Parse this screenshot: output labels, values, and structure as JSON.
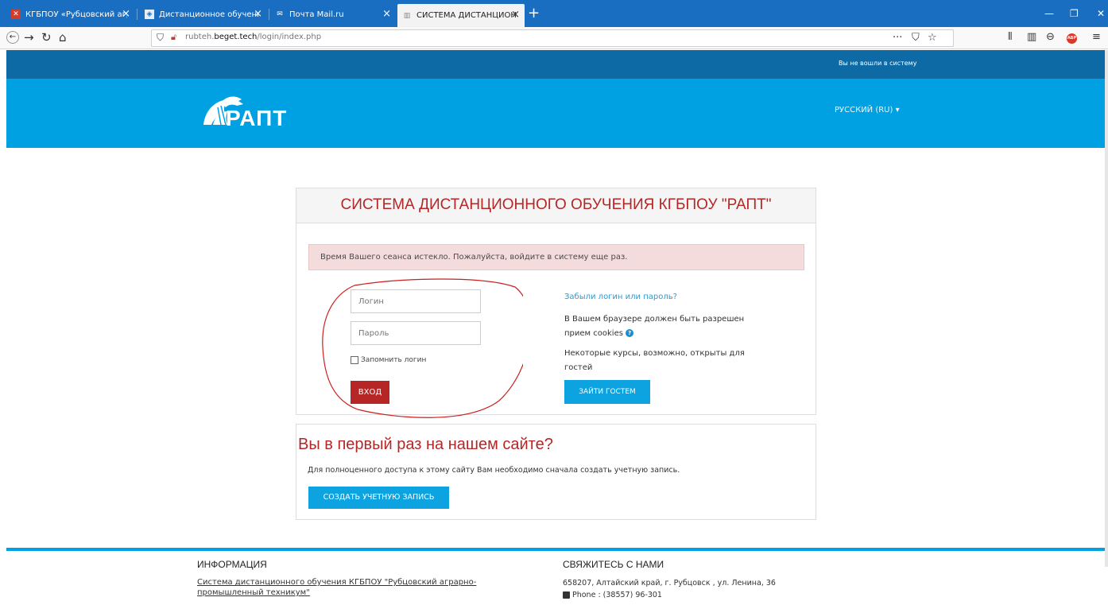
{
  "browser": {
    "tabs": [
      {
        "label": "КГБПОУ «Рубцовский аграрно",
        "active": false,
        "icon": "college-favicon-icon"
      },
      {
        "label": "Дистанционное обучение",
        "active": false,
        "icon": "shield-favicon-icon"
      },
      {
        "label": "Почта Mail.ru",
        "active": false,
        "icon": "mail-favicon-icon"
      },
      {
        "label": "СИСТЕМА ДИСТАНЦИОННО",
        "active": true,
        "icon": "moodle-favicon-icon"
      }
    ],
    "url_prefix": "rubteh.",
    "url_host": "beget.tech",
    "url_path": "/login/index.php",
    "page_actions": "···"
  },
  "site": {
    "status_text": "Вы не вошли в систему",
    "logo_text": "РАПТ",
    "language": "РУССКИЙ (RU) ▾"
  },
  "login": {
    "title": "СИСТЕМА ДИСТАНЦИОННОГО ОБУЧЕНИЯ КГБПОУ \"РАПТ\"",
    "alert": "Время Вашего сеанса истекло. Пожалуйста, войдите в систему еще раз.",
    "username_placeholder": "Логин",
    "password_placeholder": "Пароль",
    "remember_label": "Запомнить логин",
    "login_button": "ВХОД",
    "forgot_link": "Забыли логин или пароль?",
    "cookies_text": "В Вашем браузере должен быть разрешен прием cookies",
    "guest_text": "Некоторые курсы, возможно, открыты для гостей",
    "guest_button": "ЗАЙТИ ГОСТЕМ"
  },
  "signup": {
    "title": "Вы в первый раз на нашем сайте?",
    "text": "Для полноценного доступа к этому сайту Вам необходимо сначала создать учетную запись.",
    "button": "СОЗДАТЬ УЧЕТНУЮ ЗАПИСЬ"
  },
  "footer": {
    "info_heading": "ИНФОРМАЦИЯ",
    "info_link": "Система дистанционного обучения КГБПОУ \"Рубцовский аграрно-промышленный техникум\"",
    "contact_heading": "СВЯЖИТЕСЬ С НАМИ",
    "address": "658207, Алтайский край, г. Рубцовск , ул. Ленина, 36",
    "phone": "Phone : (38557) 96-301"
  },
  "colors": {
    "tabbar": "#1a6ec1",
    "strip": "#0e6aa4",
    "header": "#00a1e3",
    "accent_red": "#b52626",
    "button_blue": "#0da3e0"
  }
}
